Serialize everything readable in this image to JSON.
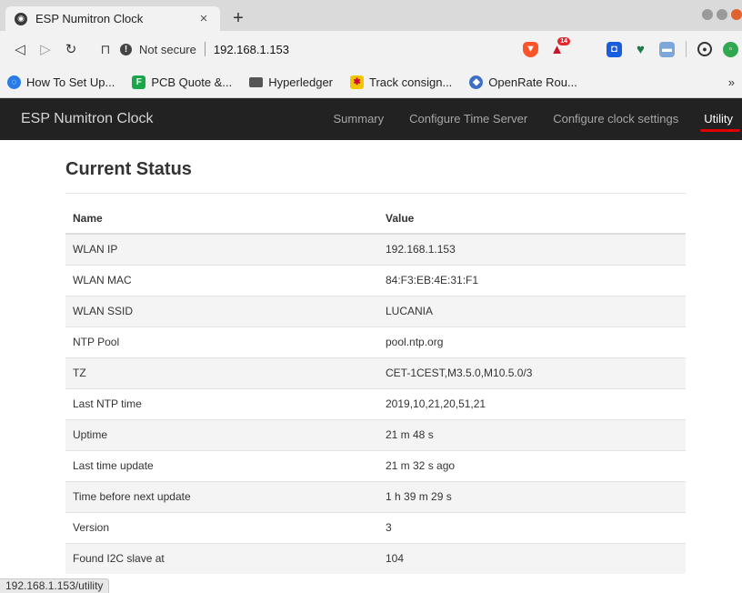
{
  "browser": {
    "tab": {
      "title": "ESP Numitron Clock",
      "close_glyph": "×"
    },
    "new_tab_glyph": "+",
    "address": {
      "security_label": "Not secure",
      "url": "192.168.1.153"
    },
    "extensions": {
      "bat_badge": "14"
    },
    "bookmarks": [
      {
        "label": "How To Set Up...",
        "icon": "digitalocean-icon"
      },
      {
        "label": "PCB Quote &...",
        "icon": "pcb-icon"
      },
      {
        "label": "Hyperledger",
        "icon": "folder-icon"
      },
      {
        "label": "Track consign...",
        "icon": "track-icon"
      },
      {
        "label": "OpenRate Rou...",
        "icon": "openrate-icon"
      }
    ],
    "bookmarks_more": "»",
    "status_url": "192.168.1.153/utility"
  },
  "site": {
    "brand": "ESP Numitron Clock",
    "nav": [
      {
        "label": "Summary"
      },
      {
        "label": "Configure Time Server"
      },
      {
        "label": "Configure clock settings"
      },
      {
        "label": "Utility",
        "active": true
      }
    ],
    "accent_color": "#e00000"
  },
  "status": {
    "title": "Current Status",
    "headers": {
      "name": "Name",
      "value": "Value"
    },
    "rows": [
      {
        "name": "WLAN IP",
        "value": "192.168.1.153"
      },
      {
        "name": "WLAN MAC",
        "value": "84:F3:EB:4E:31:F1"
      },
      {
        "name": "WLAN SSID",
        "value": "LUCANIA"
      },
      {
        "name": "NTP Pool",
        "value": "pool.ntp.org"
      },
      {
        "name": "TZ",
        "value": "CET-1CEST,M3.5.0,M10.5.0/3"
      },
      {
        "name": "Last NTP time",
        "value": "2019,10,21,20,51,21"
      },
      {
        "name": "Uptime",
        "value": "21 m 48 s"
      },
      {
        "name": "Last time update",
        "value": "21 m 32 s ago"
      },
      {
        "name": "Time before next update",
        "value": "1 h 39 m 29 s"
      },
      {
        "name": "Version",
        "value": "3"
      },
      {
        "name": "Found I2C slave at",
        "value": "104"
      }
    ]
  }
}
